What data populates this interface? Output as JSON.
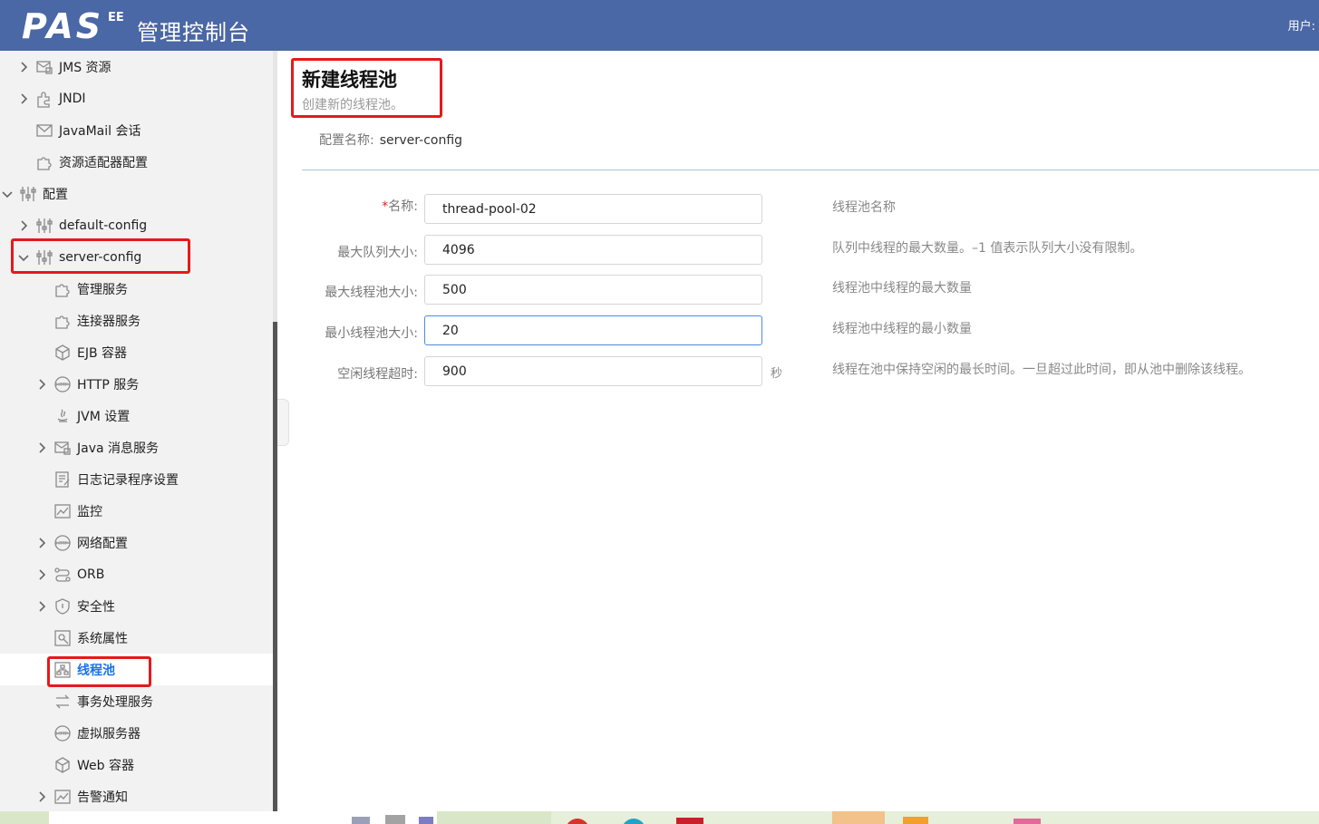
{
  "header": {
    "logo_text": "PAS",
    "logo_suffix": "EE",
    "title": "管理控制台",
    "user_label": "用户:"
  },
  "sidebar": {
    "items": [
      {
        "label": "JMS 资源",
        "icon": "jms-resource-icon",
        "expand": "collapsed"
      },
      {
        "label": "JNDI",
        "icon": "jndi-icon",
        "expand": "collapsed"
      },
      {
        "label": "JavaMail 会话",
        "icon": "mail-icon",
        "expand": "none"
      },
      {
        "label": "资源适配器配置",
        "icon": "puzzle-icon",
        "expand": "none"
      },
      {
        "label": "配置",
        "icon": "sliders-icon",
        "expand": "expanded"
      },
      {
        "label": "default-config",
        "icon": "sliders-icon",
        "expand": "collapsed"
      },
      {
        "label": "server-config",
        "icon": "sliders-icon",
        "expand": "expanded"
      },
      {
        "label": "管理服务",
        "icon": "puzzle-icon",
        "expand": "none"
      },
      {
        "label": "连接器服务",
        "icon": "puzzle-icon",
        "expand": "none"
      },
      {
        "label": "EJB 容器",
        "icon": "cube-icon",
        "expand": "none"
      },
      {
        "label": "HTTP 服务",
        "icon": "http-globe-icon",
        "expand": "collapsed"
      },
      {
        "label": "JVM 设置",
        "icon": "java-icon",
        "expand": "none"
      },
      {
        "label": "Java 消息服务",
        "icon": "jms-resource-icon",
        "expand": "collapsed"
      },
      {
        "label": "日志记录程序设置",
        "icon": "log-icon",
        "expand": "none"
      },
      {
        "label": "监控",
        "icon": "chart-icon",
        "expand": "none"
      },
      {
        "label": "网络配置",
        "icon": "http-globe-icon",
        "expand": "collapsed"
      },
      {
        "label": "ORB",
        "icon": "orb-icon",
        "expand": "collapsed"
      },
      {
        "label": "安全性",
        "icon": "shield-icon",
        "expand": "collapsed"
      },
      {
        "label": "系统属性",
        "icon": "properties-icon",
        "expand": "none"
      },
      {
        "label": "线程池",
        "icon": "thread-pool-icon",
        "expand": "none",
        "selected": true
      },
      {
        "label": "事务处理服务",
        "icon": "transaction-icon",
        "expand": "none"
      },
      {
        "label": "虚拟服务器",
        "icon": "http-globe-icon",
        "expand": "none"
      },
      {
        "label": "Web 容器",
        "icon": "cube-icon",
        "expand": "none"
      },
      {
        "label": "告警通知",
        "icon": "chart-icon",
        "expand": "collapsed"
      }
    ]
  },
  "main": {
    "title": "新建线程池",
    "subtitle": "创建新的线程池。",
    "config_name_label": "配置名称:",
    "config_name_value": "server-config",
    "fields": [
      {
        "label": "名称:",
        "required": true,
        "value": "thread-pool-02",
        "unit": "",
        "help": "线程池名称"
      },
      {
        "label": "最大队列大小:",
        "required": false,
        "value": "4096",
        "unit": "",
        "help": "队列中线程的最大数量。–1 值表示队列大小没有限制。"
      },
      {
        "label": "最大线程池大小:",
        "required": false,
        "value": "500",
        "unit": "",
        "help": "线程池中线程的最大数量"
      },
      {
        "label": "最小线程池大小:",
        "required": false,
        "value": "20",
        "unit": "",
        "help": "线程池中线程的最小数量",
        "focused": true
      },
      {
        "label": "空闲线程超时:",
        "required": false,
        "value": "900",
        "unit": "秒",
        "help": "线程在池中保持空闲的最长时间。一旦超过此时间，即从池中删除该线程。"
      }
    ]
  },
  "colors": {
    "header_bg": "#4a67a6",
    "highlight": "#e6191a",
    "selected_text": "#1a73e8"
  }
}
